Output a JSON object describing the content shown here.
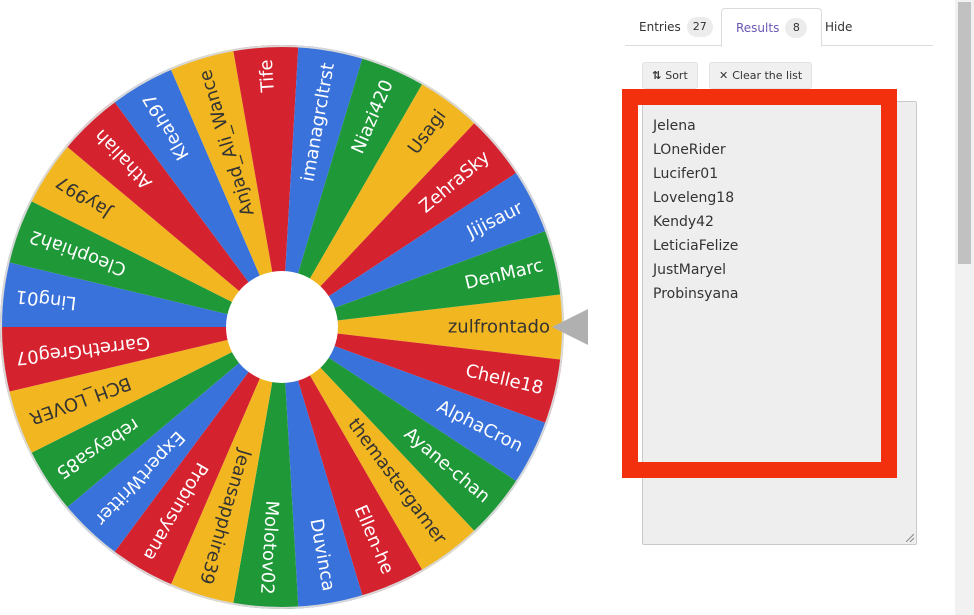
{
  "wheel": {
    "pointer_color": "#b0b0b0",
    "center_color": "#ffffff",
    "slices": [
      {
        "label": "zulfrontado",
        "color": "#f2b720"
      },
      {
        "label": "Chelle18",
        "color": "#d5222f"
      },
      {
        "label": "AlphaCron",
        "color": "#3a72db"
      },
      {
        "label": "Ayane-chan",
        "color": "#1f9838"
      },
      {
        "label": "themastergamer",
        "color": "#f2b720"
      },
      {
        "label": "Ellen-he",
        "color": "#d5222f"
      },
      {
        "label": "Duvinca",
        "color": "#3a72db"
      },
      {
        "label": "Molotov02",
        "color": "#1f9838"
      },
      {
        "label": "Jeansapphire39",
        "color": "#f2b720"
      },
      {
        "label": "Probinsyana",
        "color": "#d5222f"
      },
      {
        "label": "ExpertWritter",
        "color": "#3a72db"
      },
      {
        "label": "rebeysa85",
        "color": "#1f9838"
      },
      {
        "label": "BCH_LOVER",
        "color": "#f2b720"
      },
      {
        "label": "GarrethGreg07",
        "color": "#d5222f"
      },
      {
        "label": "Ling01",
        "color": "#3a72db"
      },
      {
        "label": "Cleophiah2",
        "color": "#1f9838"
      },
      {
        "label": "Jay997",
        "color": "#f2b720"
      },
      {
        "label": "Athaliah",
        "color": "#d5222f"
      },
      {
        "label": "Kleah97",
        "color": "#3a72db"
      },
      {
        "label": "Anjad_Ali_Wance",
        "color": "#f2b720"
      },
      {
        "label": "Tife",
        "color": "#d5222f"
      },
      {
        "label": "imanagrcltrst",
        "color": "#3a72db"
      },
      {
        "label": "Niazi420",
        "color": "#1f9838"
      },
      {
        "label": "Usagi",
        "color": "#f2b720"
      },
      {
        "label": "ZehraSky",
        "color": "#d5222f"
      },
      {
        "label": "Jijisaur",
        "color": "#3a72db"
      },
      {
        "label": "DenMarc",
        "color": "#1f9838"
      }
    ]
  },
  "tabs": {
    "entries_label": "Entries",
    "entries_count": "27",
    "results_label": "Results",
    "results_count": "8",
    "hide_label": "Hide"
  },
  "toolbar": {
    "sort_label": "Sort",
    "sort_icon": "sort-icon",
    "clear_label": "Clear the list",
    "clear_icon": "x-icon"
  },
  "results": [
    "Jelena",
    "LOneRider",
    "Lucifer01",
    "Loveleng18",
    "Kendy42",
    "LeticiaFelize",
    "JustMaryel",
    "Probinsyana"
  ],
  "colors": {
    "accent": "#6c57b5",
    "highlight": "#f2300d"
  }
}
